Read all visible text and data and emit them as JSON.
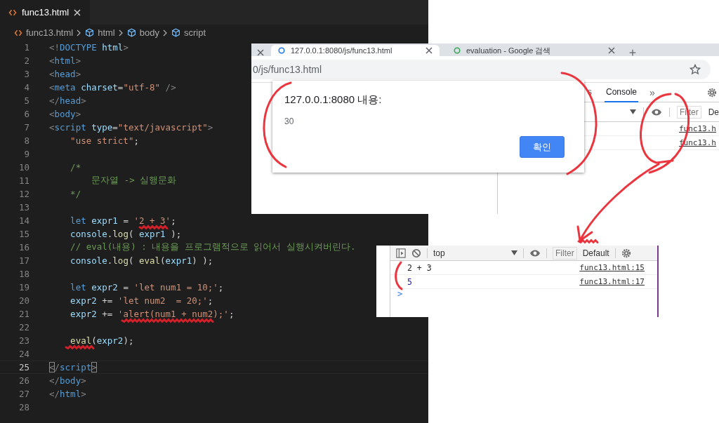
{
  "editor": {
    "tab": {
      "label": "func13.html",
      "selected": true
    },
    "breadcrumb": [
      "func13.html",
      "html",
      "body",
      "script"
    ],
    "lines": [
      {
        "number": "1",
        "current": false,
        "text": "<!DOCTYPE html>"
      },
      {
        "number": "2",
        "current": false,
        "text": "<html>"
      },
      {
        "number": "3",
        "current": false,
        "text": "<head>"
      },
      {
        "number": "4",
        "current": false,
        "text": "<meta charset=\"utf-8\" />"
      },
      {
        "number": "5",
        "current": false,
        "text": "</head>"
      },
      {
        "number": "6",
        "current": false,
        "text": "<body>"
      },
      {
        "number": "7",
        "current": false,
        "text": "<script type=\"text/javascript\">"
      },
      {
        "number": "8",
        "current": false,
        "text": "    \"use strict\";"
      },
      {
        "number": "9",
        "current": false
      },
      {
        "number": "10",
        "current": false,
        "text": "    /*"
      },
      {
        "number": "11",
        "current": false,
        "text": "        문자열 -> 실행문화"
      },
      {
        "number": "12",
        "current": false,
        "text": "    */"
      },
      {
        "number": "13",
        "current": false
      },
      {
        "number": "14",
        "current": false,
        "text": "    let expr1 = '2 + 3';"
      },
      {
        "number": "15",
        "current": false,
        "text": "    console.log( expr1 );"
      },
      {
        "number": "16",
        "current": false,
        "text": "    // eval(내용) : 내용을 프로그램적으로 읽어서 실행시켜버린다."
      },
      {
        "number": "17",
        "current": false,
        "text": "    console.log( eval(expr1) );"
      },
      {
        "number": "18",
        "current": false
      },
      {
        "number": "19",
        "current": false,
        "text": "    let expr2 = 'let num1 = 10;';"
      },
      {
        "number": "20",
        "current": false,
        "text": "    expr2 += 'let num2  = 20;';"
      },
      {
        "number": "21",
        "current": false,
        "text": "    expr2 += 'alert(num1 + num2);';"
      },
      {
        "number": "22",
        "current": false
      },
      {
        "number": "23",
        "current": false,
        "text": "    eval(expr2);"
      },
      {
        "number": "24",
        "current": false
      },
      {
        "number": "25",
        "current": true,
        "text": "</script>"
      },
      {
        "number": "26",
        "current": false,
        "text": "</body>"
      },
      {
        "number": "27",
        "current": false,
        "text": "</html>"
      },
      {
        "number": "28",
        "current": false
      }
    ]
  },
  "browser": {
    "tabs": [
      {
        "label": "127.0.0.1:8080/js/func13.html",
        "selected": true
      },
      {
        "label": "evaluation - Google 검색",
        "selected": false
      }
    ],
    "address": "0/js/func13.html",
    "devtools": {
      "tabs": [
        {
          "label": "s",
          "selected": false
        },
        {
          "label": "Console",
          "selected": true
        }
      ],
      "more": "»",
      "filter_placeholder": "Filter",
      "levels": "De",
      "rows": [
        "func13.h",
        "func13.h"
      ]
    }
  },
  "dialog": {
    "title": "127.0.0.1:8080 내용:",
    "message": "30",
    "button": "확인"
  },
  "console": {
    "context": "top",
    "filter_placeholder": "Filter",
    "levels": "Default",
    "rows": [
      {
        "text": "2 + 3",
        "kind": "string",
        "source": "func13.html:15"
      },
      {
        "text": "5",
        "kind": "number",
        "source": "func13.html:17"
      }
    ],
    "prompt": ">"
  }
}
